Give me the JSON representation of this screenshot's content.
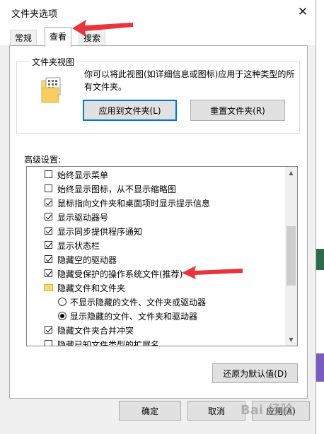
{
  "dialog": {
    "title": "文件夹选项",
    "close_icon": "close-icon"
  },
  "tabs": [
    {
      "label": "常规",
      "active": false
    },
    {
      "label": "查看",
      "active": true
    },
    {
      "label": "搜索",
      "active": false
    }
  ],
  "folder_views": {
    "group_label": "文件夹视图",
    "description": "你可以将此视图(如详细信息或图标)应用于这种类型的所有文件夹。",
    "apply_button": "应用到文件夹(L)",
    "reset_button": "重置文件夹(R)"
  },
  "advanced": {
    "label": "高级设置:",
    "items": [
      {
        "type": "checkbox",
        "label": "始终显示菜单",
        "checked": false
      },
      {
        "type": "checkbox",
        "label": "始终显示图标，从不显示缩略图",
        "checked": false
      },
      {
        "type": "checkbox",
        "label": "鼠标指向文件夹和桌面项时显示提示信息",
        "checked": true
      },
      {
        "type": "checkbox",
        "label": "显示驱动器号",
        "checked": true
      },
      {
        "type": "checkbox",
        "label": "显示同步提供程序通知",
        "checked": true
      },
      {
        "type": "checkbox",
        "label": "显示状态栏",
        "checked": true
      },
      {
        "type": "checkbox",
        "label": "隐藏空的驱动器",
        "checked": true
      },
      {
        "type": "checkbox",
        "label": "隐藏受保护的操作系统文件(推荐)",
        "checked": true
      },
      {
        "type": "folder",
        "label": "隐藏文件和文件夹"
      },
      {
        "type": "radio",
        "label": "不显示隐藏的文件、文件夹或驱动器",
        "checked": false
      },
      {
        "type": "radio",
        "label": "显示隐藏的文件、文件夹和驱动器",
        "checked": true
      },
      {
        "type": "checkbox",
        "label": "隐藏文件夹合并冲突",
        "checked": true
      },
      {
        "type": "checkbox",
        "label": "隐藏已知文件类型的扩展名",
        "checked": false
      }
    ],
    "restore_button": "还原为默认值(D)"
  },
  "footer": {
    "ok_button": "确定",
    "cancel_button": "取消",
    "apply_button": "应用(A)"
  },
  "watermark": "Bai 经验",
  "colors": {
    "annotation_arrow": "#e8343a",
    "focus_border": "#0078d7",
    "folder_yellow": "#f8d775"
  }
}
